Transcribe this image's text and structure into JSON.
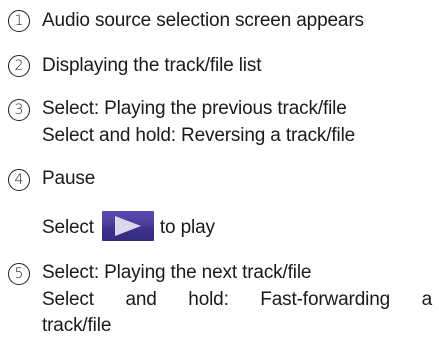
{
  "items": [
    {
      "number": "1",
      "lines": [
        "Audio source selection screen appears"
      ]
    },
    {
      "number": "2",
      "lines": [
        "Displaying the track/file list"
      ]
    },
    {
      "number": "3",
      "lines": [
        "Select: Playing the previous track/file",
        "Select and hold: Reversing a track/file"
      ]
    },
    {
      "number": "4",
      "lines": [
        "Pause"
      ],
      "select_prefix": "Select",
      "select_suffix": "to play",
      "button_icon": "play-icon"
    },
    {
      "number": "5",
      "lines": [
        "Select: Playing the next track/file",
        "Select and hold: Fast-forwarding a",
        "track/file"
      ]
    }
  ],
  "colors": {
    "button_top": "#5b4bb0",
    "button_bottom": "#352a80",
    "triangle": "#dcd8ec"
  }
}
